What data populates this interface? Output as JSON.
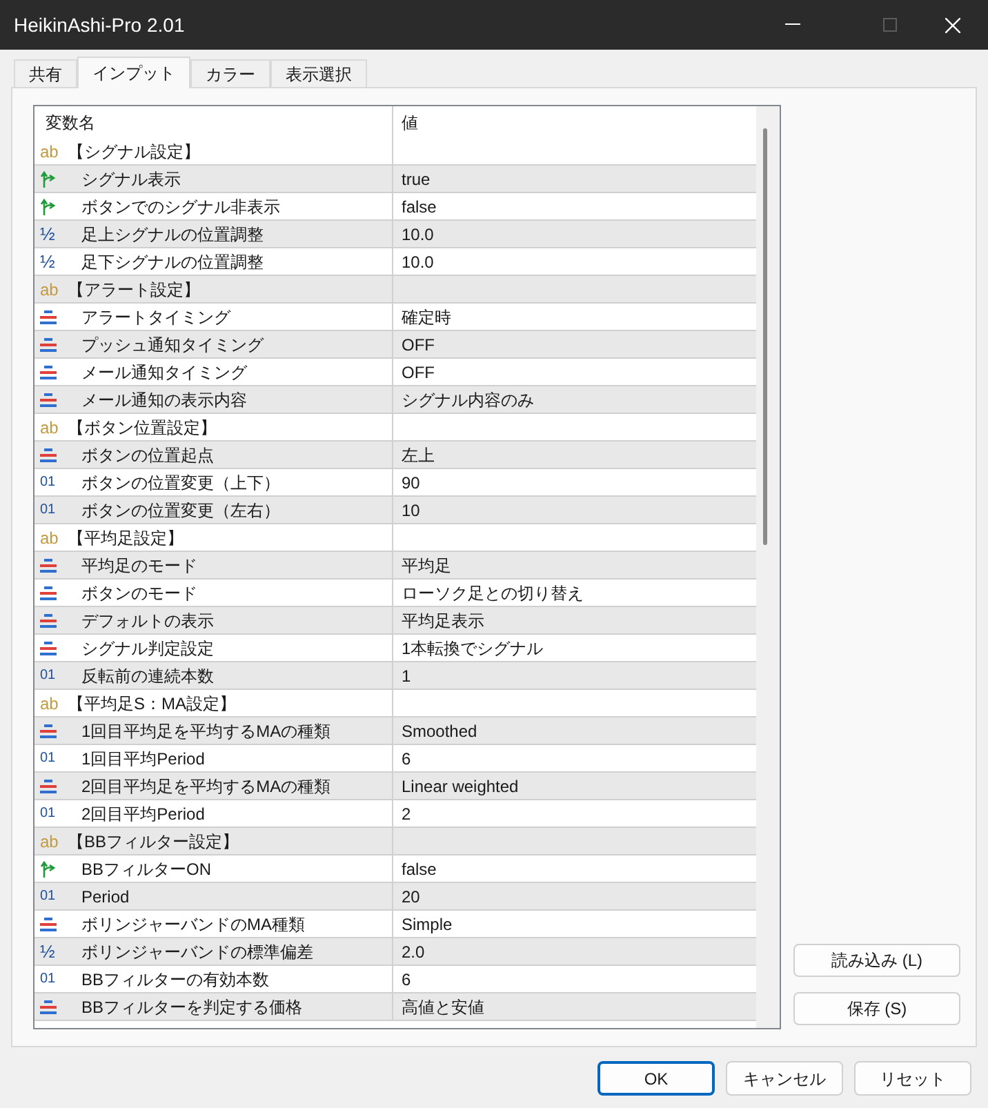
{
  "window": {
    "title": "HeikinAshi-Pro 2.01"
  },
  "tabs": [
    {
      "label": "共有",
      "selected": false
    },
    {
      "label": "インプット",
      "selected": true
    },
    {
      "label": "カラー",
      "selected": false
    },
    {
      "label": "表示選択",
      "selected": false
    }
  ],
  "table": {
    "columns": [
      "変数名",
      "値"
    ],
    "rows": [
      {
        "kind": "group",
        "icon": "ab",
        "name": "【シグナル設定】"
      },
      {
        "kind": "bool",
        "name": "シグナル表示",
        "value": "true"
      },
      {
        "kind": "bool",
        "name": "ボタンでのシグナル非表示",
        "value": "false"
      },
      {
        "kind": "double",
        "icon": "½",
        "name": "足上シグナルの位置調整",
        "value": "10.0"
      },
      {
        "kind": "double",
        "icon": "½",
        "name": "足下シグナルの位置調整",
        "value": "10.0"
      },
      {
        "kind": "group",
        "icon": "ab",
        "name": "【アラート設定】"
      },
      {
        "kind": "enum",
        "name": "アラートタイミング",
        "value": "確定時"
      },
      {
        "kind": "enum",
        "name": "プッシュ通知タイミング",
        "value": "OFF"
      },
      {
        "kind": "enum",
        "name": "メール通知タイミング",
        "value": "OFF"
      },
      {
        "kind": "enum",
        "name": "メール通知の表示内容",
        "value": "シグナル内容のみ"
      },
      {
        "kind": "group",
        "icon": "ab",
        "name": "【ボタン位置設定】"
      },
      {
        "kind": "enum",
        "name": "ボタンの位置起点",
        "value": "左上"
      },
      {
        "kind": "int",
        "icon": "01",
        "name": "ボタンの位置変更（上下）",
        "value": "90"
      },
      {
        "kind": "int",
        "icon": "01",
        "name": "ボタンの位置変更（左右）",
        "value": "10"
      },
      {
        "kind": "group",
        "icon": "ab",
        "name": "【平均足設定】"
      },
      {
        "kind": "enum",
        "name": "平均足のモード",
        "value": "平均足"
      },
      {
        "kind": "enum",
        "name": "ボタンのモード",
        "value": "ローソク足との切り替え"
      },
      {
        "kind": "enum",
        "name": "デフォルトの表示",
        "value": "平均足表示"
      },
      {
        "kind": "enum",
        "name": "シグナル判定設定",
        "value": "1本転換でシグナル"
      },
      {
        "kind": "int",
        "icon": "01",
        "name": "反転前の連続本数",
        "value": "1"
      },
      {
        "kind": "group",
        "icon": "ab",
        "name": "【平均足S：MA設定】"
      },
      {
        "kind": "enum",
        "name": "1回目平均足を平均するMAの種類",
        "value": "Smoothed"
      },
      {
        "kind": "int",
        "icon": "01",
        "name": "1回目平均Period",
        "value": "6"
      },
      {
        "kind": "enum",
        "name": "2回目平均足を平均するMAの種類",
        "value": "Linear weighted"
      },
      {
        "kind": "int",
        "icon": "01",
        "name": "2回目平均Period",
        "value": "2"
      },
      {
        "kind": "group",
        "icon": "ab",
        "name": "【BBフィルター設定】"
      },
      {
        "kind": "bool",
        "name": "BBフィルターON",
        "value": "false"
      },
      {
        "kind": "int",
        "icon": "01",
        "name": "Period",
        "value": "20"
      },
      {
        "kind": "enum",
        "name": "ボリンジャーバンドのMA種類",
        "value": "Simple"
      },
      {
        "kind": "double",
        "icon": "½",
        "name": "ボリンジャーバンドの標準偏差",
        "value": "2.0"
      },
      {
        "kind": "int",
        "icon": "01",
        "name": "BBフィルターの有効本数",
        "value": "6"
      },
      {
        "kind": "enum",
        "name": "BBフィルターを判定する価格",
        "value": "高値と安値"
      }
    ]
  },
  "side_buttons": [
    "読み込み (L)",
    "保存 (S)"
  ],
  "buttons": [
    {
      "label": "OK",
      "focused": true
    },
    {
      "label": "キャンセル",
      "focused": false
    },
    {
      "label": "リセット",
      "focused": false
    }
  ]
}
